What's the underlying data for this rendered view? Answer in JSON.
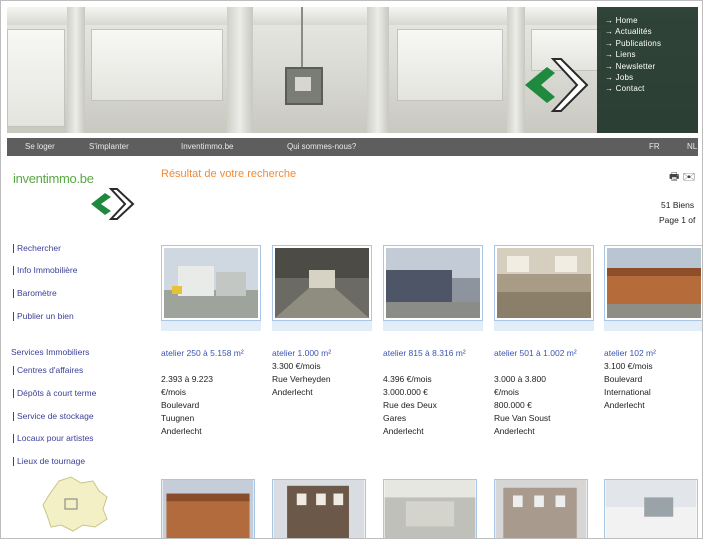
{
  "header": {
    "menu_items": [
      "→ Home",
      "→ Actualités",
      "→ Publications",
      "→ Liens",
      "→ Newsletter",
      "→ Jobs",
      "→ Contact"
    ]
  },
  "navbar": {
    "links": [
      "Se loger",
      "S'implanter",
      "Inventimmo.be",
      "Qui sommes-nous?"
    ],
    "right_links": [
      "FR",
      "NL"
    ]
  },
  "sidebar": {
    "logo_text": "inventimmo.be",
    "links": [
      "Rechercher",
      "Info Immobilière",
      "Baromètre",
      "Publier un bien"
    ],
    "services_heading": "Services Immobiliers",
    "services": [
      "Centres d'affaires",
      "Dépôts à court terme",
      "Service de stockage",
      "Locaux pour artistes",
      "Lieux de tournage"
    ]
  },
  "main": {
    "title": "Résultat de votre recherche",
    "tool_icons": "🖶 ✉",
    "result_count": "51 Biens",
    "page_info": "Page 1 of",
    "listings": [
      {
        "title": "atelier 250 à 5.158 m²",
        "info": [
          "2.393 à 9.223",
          "€/mois",
          "Boulevard",
          "Tuugnen",
          "Anderlecht"
        ]
      },
      {
        "title": "atelier 1.000 m²",
        "info": [
          "3.300 €/mois",
          "Rue Verheyden",
          "Anderlecht"
        ]
      },
      {
        "title": "atelier 815 à 8.316 m²",
        "info": [
          "4.396 €/mois",
          "3.000.000 €",
          "Rue des Deux",
          "Gares",
          "Anderlecht"
        ]
      },
      {
        "title": "atelier 501 à 1.002 m²",
        "info": [
          "3.000 à 3.800",
          "€/mois",
          "800.000 €",
          "Rue Van Soust",
          "Anderlecht"
        ]
      },
      {
        "title": "atelier 102 m²",
        "info": [
          "3.100 €/mois",
          "Boulevard",
          "International",
          "Anderlecht"
        ]
      }
    ]
  },
  "colors": {
    "accent_orange": "#f08b34",
    "link_blue": "#3a55b4",
    "logo_green": "#5aa845",
    "navbar": "#5e5e5e",
    "menu_panel": "#12281c"
  }
}
